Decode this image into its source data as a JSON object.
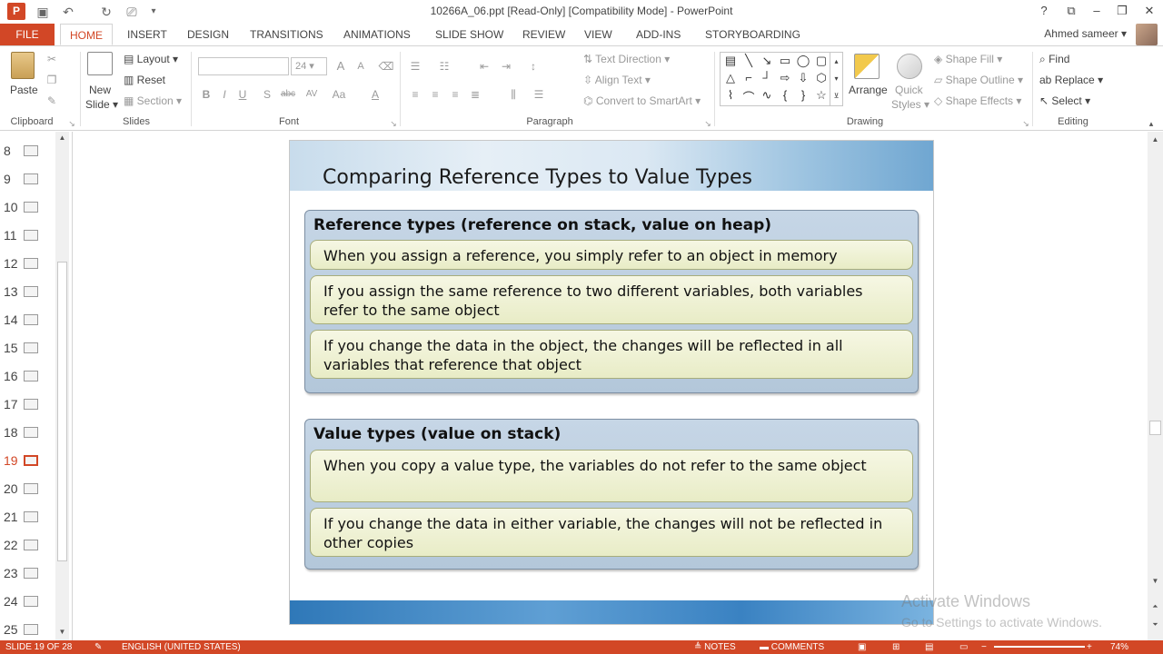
{
  "window": {
    "title": "10266A_06.ppt [Read-Only] [Compatibility Mode] - PowerPoint",
    "help": "?",
    "minimize": "–",
    "maximize": "❐",
    "close": "✕",
    "restore": "⧉"
  },
  "qat": {
    "app_logo": "P",
    "save": "💾",
    "undo": "↶",
    "redo": "↻",
    "start": "⎚",
    "customize": "▾"
  },
  "tabs": [
    "FILE",
    "HOME",
    "INSERT",
    "DESIGN",
    "TRANSITIONS",
    "ANIMATIONS",
    "SLIDE SHOW",
    "REVIEW",
    "VIEW",
    "ADD-INS",
    "STORYBOARDING"
  ],
  "user": {
    "name": "Ahmed sameer"
  },
  "ribbon": {
    "clipboard": {
      "paste": "Paste",
      "label": "Clipboard"
    },
    "slides": {
      "new_slide": "New",
      "new_slide2": "Slide",
      "layout": "Layout",
      "reset": "Reset",
      "section": "Section",
      "label": "Slides"
    },
    "font": {
      "size": "24",
      "label": "Font",
      "bold": "B",
      "italic": "I",
      "underline": "U",
      "shadow": "S",
      "strike": "abc",
      "spacing": "AV",
      "case": "Aa",
      "color": "A",
      "grow": "A",
      "shrink": "A"
    },
    "paragraph": {
      "text_direction": "Text Direction",
      "align_text": "Align Text",
      "convert": "Convert to SmartArt",
      "label": "Paragraph"
    },
    "drawing": {
      "arrange": "Arrange",
      "quick": "Quick",
      "styles": "Styles",
      "shape_fill": "Shape Fill",
      "shape_outline": "Shape Outline",
      "shape_effects": "Shape Effects",
      "label": "Drawing"
    },
    "editing": {
      "find": "Find",
      "replace": "Replace",
      "select": "Select",
      "label": "Editing"
    }
  },
  "thumbnails": [
    {
      "num": "8"
    },
    {
      "num": "9"
    },
    {
      "num": "10"
    },
    {
      "num": "11"
    },
    {
      "num": "12"
    },
    {
      "num": "13"
    },
    {
      "num": "14"
    },
    {
      "num": "15"
    },
    {
      "num": "16"
    },
    {
      "num": "17"
    },
    {
      "num": "18"
    },
    {
      "num": "19",
      "selected": true
    },
    {
      "num": "20"
    },
    {
      "num": "21"
    },
    {
      "num": "22"
    },
    {
      "num": "23"
    },
    {
      "num": "24"
    },
    {
      "num": "25"
    }
  ],
  "slide": {
    "title": "Comparing Reference Types to Value Types",
    "panel1": {
      "heading": "Reference types (reference on stack, value on heap)",
      "bullets": [
        "When you assign a reference, you simply refer to an object in memory",
        "If you assign the same reference to two different variables, both variables refer to the same object",
        "If you change the data in the object, the changes will be reflected in all variables that reference that object"
      ]
    },
    "panel2": {
      "heading": "Value types (value on stack)",
      "bullets": [
        "When you copy a value type, the variables do not refer to the same object",
        "If you change the data in either variable, the changes will not be reflected in other copies"
      ]
    }
  },
  "watermark": {
    "line1": "Activate Windows",
    "line2": "Go to Settings to activate Windows."
  },
  "status": {
    "slide": "SLIDE 19 OF 28",
    "language": "ENGLISH (UNITED STATES)",
    "notes": "NOTES",
    "comments": "COMMENTS",
    "zoom": "74%"
  },
  "colors": {
    "accent": "#d24726"
  }
}
